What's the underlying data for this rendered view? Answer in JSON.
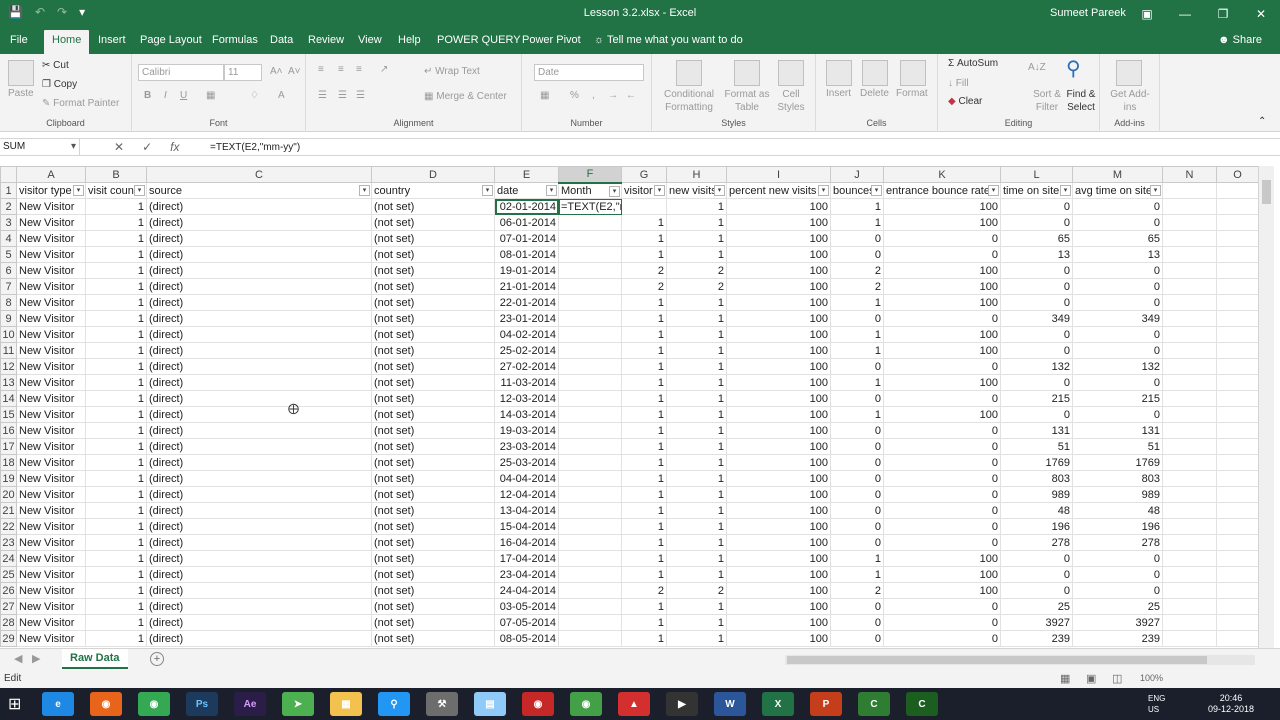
{
  "window": {
    "title": "Lesson 3.2.xlsx - Excel",
    "user": "Sumeet Pareek"
  },
  "tabs": [
    "File",
    "Home",
    "Insert",
    "Page Layout",
    "Formulas",
    "Data",
    "Review",
    "View",
    "Help",
    "POWER QUERY",
    "Power Pivot"
  ],
  "tell_me": "Tell me what you want to do",
  "share": "Share",
  "ribbon": {
    "clipboard": {
      "label": "Clipboard",
      "paste": "Paste",
      "cut": "Cut",
      "copy": "Copy",
      "format_painter": "Format Painter"
    },
    "font": {
      "label": "Font",
      "name": "Calibri",
      "size": "11"
    },
    "alignment": {
      "label": "Alignment",
      "wrap": "Wrap Text",
      "merge": "Merge & Center"
    },
    "number": {
      "label": "Number",
      "format": "Date"
    },
    "styles": {
      "label": "Styles",
      "cond": "Conditional Formatting",
      "fmt_table": "Format as Table",
      "cell_styles": "Cell Styles"
    },
    "cells": {
      "label": "Cells",
      "insert": "Insert",
      "delete": "Delete",
      "format": "Format"
    },
    "editing": {
      "label": "Editing",
      "autosum": "AutoSum",
      "fill": "Fill",
      "clear": "Clear",
      "sort": "Sort & Filter",
      "find": "Find & Select"
    },
    "addins": {
      "label": "Add-ins",
      "get": "Get Add-ins"
    }
  },
  "name_box": "SUM",
  "formula": "=TEXT(E2,\"mm-yy\")",
  "columns": [
    "A",
    "B",
    "C",
    "D",
    "E",
    "F",
    "G",
    "H",
    "I",
    "J",
    "K",
    "L",
    "M",
    "N",
    "O"
  ],
  "headers": [
    "visitor type",
    "visit count",
    "source",
    "country",
    "date",
    "Month",
    "visitor",
    "new visits",
    "percent new visits",
    "bounces",
    "entrance bounce rate",
    "time on site",
    "avg time on site"
  ],
  "rows": [
    [
      "New Visitor",
      "1",
      "(direct)",
      "(not set)",
      "02-01-2014",
      "=TEXT(E2,\"mm-yy\")",
      "",
      "1",
      "100",
      "1",
      "100",
      "0",
      "0"
    ],
    [
      "New Visitor",
      "1",
      "(direct)",
      "(not set)",
      "06-01-2014",
      "",
      "1",
      "1",
      "100",
      "1",
      "100",
      "0",
      "0"
    ],
    [
      "New Visitor",
      "1",
      "(direct)",
      "(not set)",
      "07-01-2014",
      "",
      "1",
      "1",
      "100",
      "0",
      "0",
      "65",
      "65"
    ],
    [
      "New Visitor",
      "1",
      "(direct)",
      "(not set)",
      "08-01-2014",
      "",
      "1",
      "1",
      "100",
      "0",
      "0",
      "13",
      "13"
    ],
    [
      "New Visitor",
      "1",
      "(direct)",
      "(not set)",
      "19-01-2014",
      "",
      "2",
      "2",
      "100",
      "2",
      "100",
      "0",
      "0"
    ],
    [
      "New Visitor",
      "1",
      "(direct)",
      "(not set)",
      "21-01-2014",
      "",
      "2",
      "2",
      "100",
      "2",
      "100",
      "0",
      "0"
    ],
    [
      "New Visitor",
      "1",
      "(direct)",
      "(not set)",
      "22-01-2014",
      "",
      "1",
      "1",
      "100",
      "1",
      "100",
      "0",
      "0"
    ],
    [
      "New Visitor",
      "1",
      "(direct)",
      "(not set)",
      "23-01-2014",
      "",
      "1",
      "1",
      "100",
      "0",
      "0",
      "349",
      "349"
    ],
    [
      "New Visitor",
      "1",
      "(direct)",
      "(not set)",
      "04-02-2014",
      "",
      "1",
      "1",
      "100",
      "1",
      "100",
      "0",
      "0"
    ],
    [
      "New Visitor",
      "1",
      "(direct)",
      "(not set)",
      "25-02-2014",
      "",
      "1",
      "1",
      "100",
      "1",
      "100",
      "0",
      "0"
    ],
    [
      "New Visitor",
      "1",
      "(direct)",
      "(not set)",
      "27-02-2014",
      "",
      "1",
      "1",
      "100",
      "0",
      "0",
      "132",
      "132"
    ],
    [
      "New Visitor",
      "1",
      "(direct)",
      "(not set)",
      "11-03-2014",
      "",
      "1",
      "1",
      "100",
      "1",
      "100",
      "0",
      "0"
    ],
    [
      "New Visitor",
      "1",
      "(direct)",
      "(not set)",
      "12-03-2014",
      "",
      "1",
      "1",
      "100",
      "0",
      "0",
      "215",
      "215"
    ],
    [
      "New Visitor",
      "1",
      "(direct)",
      "(not set)",
      "14-03-2014",
      "",
      "1",
      "1",
      "100",
      "1",
      "100",
      "0",
      "0"
    ],
    [
      "New Visitor",
      "1",
      "(direct)",
      "(not set)",
      "19-03-2014",
      "",
      "1",
      "1",
      "100",
      "0",
      "0",
      "131",
      "131"
    ],
    [
      "New Visitor",
      "1",
      "(direct)",
      "(not set)",
      "23-03-2014",
      "",
      "1",
      "1",
      "100",
      "0",
      "0",
      "51",
      "51"
    ],
    [
      "New Visitor",
      "1",
      "(direct)",
      "(not set)",
      "25-03-2014",
      "",
      "1",
      "1",
      "100",
      "0",
      "0",
      "1769",
      "1769"
    ],
    [
      "New Visitor",
      "1",
      "(direct)",
      "(not set)",
      "04-04-2014",
      "",
      "1",
      "1",
      "100",
      "0",
      "0",
      "803",
      "803"
    ],
    [
      "New Visitor",
      "1",
      "(direct)",
      "(not set)",
      "12-04-2014",
      "",
      "1",
      "1",
      "100",
      "0",
      "0",
      "989",
      "989"
    ],
    [
      "New Visitor",
      "1",
      "(direct)",
      "(not set)",
      "13-04-2014",
      "",
      "1",
      "1",
      "100",
      "0",
      "0",
      "48",
      "48"
    ],
    [
      "New Visitor",
      "1",
      "(direct)",
      "(not set)",
      "15-04-2014",
      "",
      "1",
      "1",
      "100",
      "0",
      "0",
      "196",
      "196"
    ],
    [
      "New Visitor",
      "1",
      "(direct)",
      "(not set)",
      "16-04-2014",
      "",
      "1",
      "1",
      "100",
      "0",
      "0",
      "278",
      "278"
    ],
    [
      "New Visitor",
      "1",
      "(direct)",
      "(not set)",
      "17-04-2014",
      "",
      "1",
      "1",
      "100",
      "1",
      "100",
      "0",
      "0"
    ],
    [
      "New Visitor",
      "1",
      "(direct)",
      "(not set)",
      "23-04-2014",
      "",
      "1",
      "1",
      "100",
      "1",
      "100",
      "0",
      "0"
    ],
    [
      "New Visitor",
      "1",
      "(direct)",
      "(not set)",
      "24-04-2014",
      "",
      "2",
      "2",
      "100",
      "2",
      "100",
      "0",
      "0"
    ],
    [
      "New Visitor",
      "1",
      "(direct)",
      "(not set)",
      "03-05-2014",
      "",
      "1",
      "1",
      "100",
      "0",
      "0",
      "25",
      "25"
    ],
    [
      "New Visitor",
      "1",
      "(direct)",
      "(not set)",
      "07-05-2014",
      "",
      "1",
      "1",
      "100",
      "0",
      "0",
      "3927",
      "3927"
    ],
    [
      "New Visitor",
      "1",
      "(direct)",
      "(not set)",
      "08-05-2014",
      "",
      "1",
      "1",
      "100",
      "0",
      "0",
      "239",
      "239"
    ]
  ],
  "sheet_tab": "Raw Data",
  "status": "Edit",
  "zoom": "100%",
  "clock": {
    "time": "20:46",
    "date": "09-12-2018"
  },
  "lang": {
    "line1": "ENG",
    "line2": "US"
  },
  "colors": {
    "brand": "#217346",
    "taskbar": "#1a1f2b"
  }
}
